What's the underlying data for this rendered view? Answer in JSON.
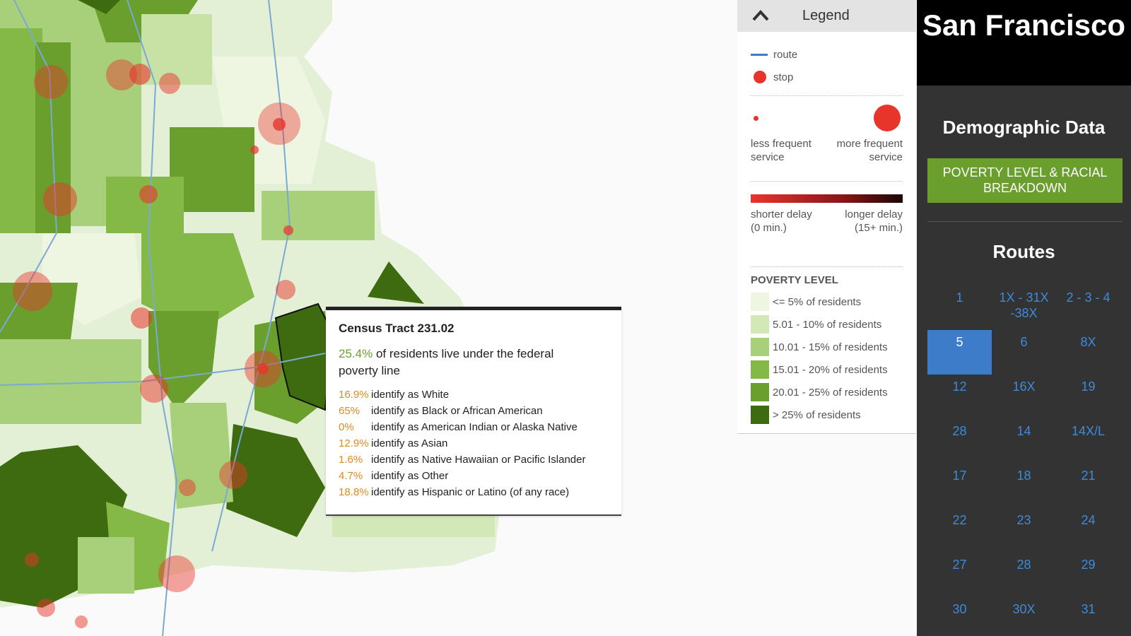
{
  "colors": {
    "accent_green": "#6a9f2d",
    "route_blue": "#3d7cc9",
    "stop_red": "#e8352c",
    "panel_bg": "#333333",
    "active_route": "#3d7cc9",
    "percent_orange": "#e08a1e"
  },
  "tooltip": {
    "title": "Census Tract 231.02",
    "poverty_pct": "25.4%",
    "poverty_text": "of residents live under the federal poverty line",
    "race": [
      {
        "pct": "16.9%",
        "label": "identify as White"
      },
      {
        "pct": "65%",
        "label": "identify as Black or African American"
      },
      {
        "pct": "0%",
        "label": "identify as American Indian or Alaska Native"
      },
      {
        "pct": "12.9%",
        "label": "identify as Asian"
      },
      {
        "pct": "1.6%",
        "label": "identify as Native Hawaiian or Pacific Islander"
      },
      {
        "pct": "4.7%",
        "label": "identify as Other"
      },
      {
        "pct": "18.8%",
        "label": "identify as Hispanic or Latino (of any race)"
      }
    ]
  },
  "legend": {
    "title": "Legend",
    "toggle_icon": "chevron-up-icon",
    "route_label": "route",
    "stop_label": "stop",
    "freq_less": "less frequent service",
    "freq_more": "more frequent service",
    "delay_short": "shorter delay (0 min.)",
    "delay_long": "longer delay (15+ min.)",
    "poverty_title": "POVERTY LEVEL",
    "poverty_levels": [
      {
        "label": "<= 5% of residents",
        "color": "#eef6e2"
      },
      {
        "label": "5.01 - 10% of residents",
        "color": "#d2e8b6"
      },
      {
        "label": "10.01 - 15% of residents",
        "color": "#a8d07a"
      },
      {
        "label": "15.01 - 20% of residents",
        "color": "#85b947"
      },
      {
        "label": "20.01 - 25% of residents",
        "color": "#6a9f2d"
      },
      {
        "label": "> 25% of residents",
        "color": "#3e6b10"
      }
    ]
  },
  "panel": {
    "city": "San Francisco",
    "demo_title": "Demographic Data",
    "demo_button": "POVERTY LEVEL & RACIAL BREAKDOWN",
    "routes_title": "Routes",
    "routes": [
      "1",
      "1X - 31X -38X",
      "2 - 3 - 4",
      "5",
      "6",
      "8X",
      "12",
      "16X",
      "19",
      "28",
      "14",
      "14X/L",
      "17",
      "18",
      "21",
      "22",
      "23",
      "24",
      "27",
      "28",
      "29",
      "30",
      "30X",
      "31"
    ],
    "active_route": "5"
  }
}
